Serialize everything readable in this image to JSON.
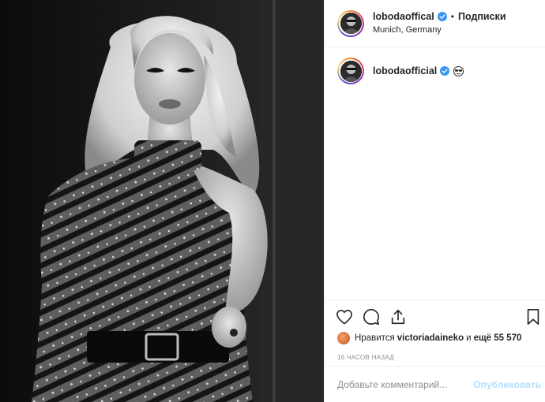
{
  "post": {
    "username": "lobodaoffical",
    "follow_label": "Подписки",
    "location": "Munich, Germany",
    "caption_username": "lobodaofficial"
  },
  "likes": {
    "prefix": "Нравится",
    "user": "victoriadaineko",
    "middle": "и",
    "count_text": "ещё 55 570"
  },
  "timestamp": "16 часов назад",
  "comment": {
    "placeholder": "Добавьте комментарий...",
    "post_label": "Опубликовать"
  },
  "colors": {
    "verified": "#3897f0",
    "post_disabled": "#b2dffc",
    "muted": "#8e8e8e"
  },
  "icons": {
    "like": "heart-icon",
    "comment": "comment-icon",
    "share": "share-icon",
    "save": "bookmark-icon",
    "verified": "verified-badge-icon",
    "caption_emoji": "sunglasses-emoji-icon"
  }
}
